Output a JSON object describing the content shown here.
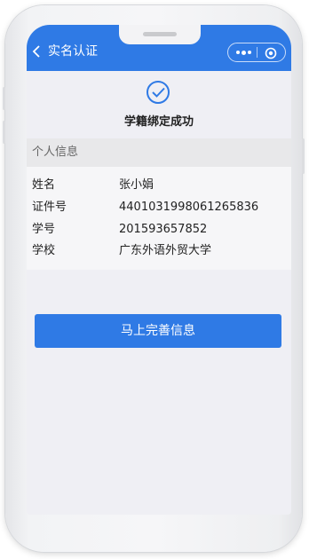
{
  "header": {
    "back_icon": "chevron-left-icon",
    "title": "实名认证",
    "more_icon": "more-dots-icon",
    "close_icon": "target-close-icon"
  },
  "status": {
    "icon": "check-circle-icon",
    "text": "学籍绑定成功"
  },
  "personal_info": {
    "section_title": "个人信息",
    "rows": [
      {
        "label": "姓名",
        "value": "张小娟"
      },
      {
        "label": "证件号",
        "value": "4401031998061265836"
      },
      {
        "label": "学号",
        "value": "201593657852"
      },
      {
        "label": "学校",
        "value": "广东外语外贸大学"
      }
    ]
  },
  "actions": {
    "complete_button": "马上完善信息"
  },
  "colors": {
    "primary": "#2f7ae5",
    "background": "#efeff4"
  }
}
